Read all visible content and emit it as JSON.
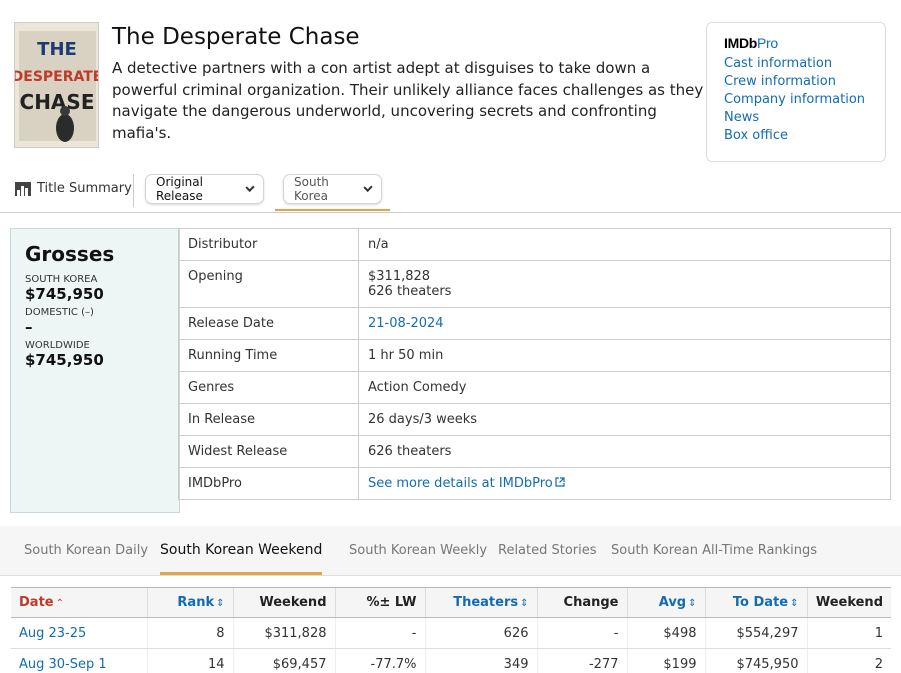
{
  "movie": {
    "poster_text": [
      "THE",
      "DESPERATE",
      "CHASE"
    ],
    "title": "The Desperate Chase",
    "synopsis": "A detective partners with a con artist adept at disguises to take down a powerful criminal organization. Their unlikely alliance faces challenges as they navigate the dangerous underworld, uncovering secrets and confronting mafia's."
  },
  "imdbpro": {
    "logo_main": "IMDb",
    "logo_pro": "Pro",
    "links": [
      "Cast information",
      "Crew information",
      "Company information",
      "News",
      "Box office"
    ]
  },
  "selectors": {
    "title_summary": "Title Summary",
    "release": "Original Release",
    "region": "South Korea"
  },
  "grosses": {
    "heading": "Grosses",
    "south_korea_label": "SOUTH KOREA",
    "south_korea_value": "$745,950",
    "domestic_label": "DOMESTIC (–)",
    "domestic_value": "–",
    "worldwide_label": "WORLDWIDE",
    "worldwide_value": "$745,950"
  },
  "details": [
    {
      "key": "Distributor",
      "value": "n/a"
    },
    {
      "key": "Opening",
      "value": "$311,828",
      "value2": "626 theaters"
    },
    {
      "key": "Release Date",
      "value": "21-08-2024",
      "link": true
    },
    {
      "key": "Running Time",
      "value": "1 hr 50 min"
    },
    {
      "key": "Genres",
      "value": "Action Comedy"
    },
    {
      "key": "In Release",
      "value": "26 days/3 weeks"
    },
    {
      "key": "Widest Release",
      "value": "626 theaters"
    },
    {
      "key": "IMDbPro",
      "value": "See more details at IMDbPro",
      "link": true
    }
  ],
  "section_tabs": [
    "South Korean Daily",
    "South Korean Weekend",
    "South Korean Weekly",
    "Related Stories",
    "South Korean All-Time Rankings"
  ],
  "active_tab": "South Korean Weekend",
  "weekend_table": {
    "headers": [
      "Date",
      "Rank",
      "Weekend",
      "%± LW",
      "Theaters",
      "Change",
      "Avg",
      "To Date",
      "Weekend"
    ],
    "rows": [
      [
        "Aug 23-25",
        "8",
        "$311,828",
        "-",
        "626",
        "-",
        "$498",
        "$554,297",
        "1"
      ],
      [
        "Aug 30-Sep 1",
        "14",
        "$69,457",
        "-77.7%",
        "349",
        "-277",
        "$199",
        "$745,950",
        "2"
      ]
    ]
  },
  "colors": {
    "link": "#136cb2",
    "accent_underline": "#e3a34a",
    "negative": "#c0392b",
    "grosses_bg": "#eef5f5"
  }
}
